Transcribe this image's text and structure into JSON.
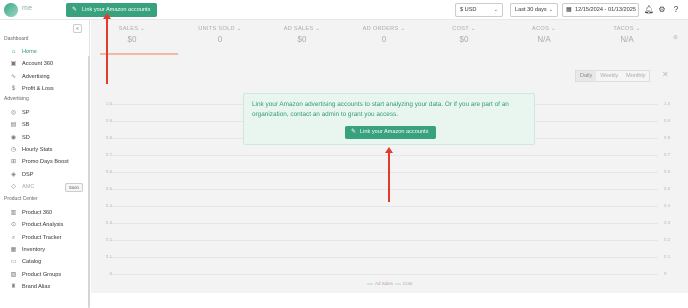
{
  "app": {
    "logo_text": "me"
  },
  "topbar": {
    "link_button": "Link your Amazon accounts",
    "currency": "$ USD",
    "range": "Last 30 days",
    "dates": "12/15/2024 - 01/13/2025"
  },
  "sidebar": {
    "sections": [
      {
        "title": "Dashboard",
        "items": [
          {
            "label": "Home",
            "icon": "home-icon",
            "glyph": "⌂",
            "active": true
          },
          {
            "label": "Account 360",
            "icon": "account-icon",
            "glyph": "▣"
          },
          {
            "label": "Advertising",
            "icon": "trend-icon",
            "glyph": "∿"
          },
          {
            "label": "Profit & Loss",
            "icon": "dollar-icon",
            "glyph": "$"
          }
        ]
      },
      {
        "title": "Advertising",
        "items": [
          {
            "label": "SP",
            "icon": "sp-icon",
            "glyph": "◎"
          },
          {
            "label": "SB",
            "icon": "sb-icon",
            "glyph": "▤"
          },
          {
            "label": "SD",
            "icon": "sd-icon",
            "glyph": "◉"
          },
          {
            "label": "Hourly Stats",
            "icon": "clock-icon",
            "glyph": "◷"
          },
          {
            "label": "Promo Days Boost",
            "icon": "boost-icon",
            "glyph": "⊞"
          },
          {
            "label": "DSP",
            "icon": "dsp-icon",
            "glyph": "◈"
          },
          {
            "label": "AMC",
            "icon": "amc-icon",
            "glyph": "◇",
            "disabled": true,
            "badge": "Soon"
          }
        ]
      },
      {
        "title": "Product Center",
        "items": [
          {
            "label": "Product 360",
            "icon": "product-icon",
            "glyph": "▥"
          },
          {
            "label": "Product Analysis",
            "icon": "analysis-icon",
            "glyph": "⊙"
          },
          {
            "label": "Product Tracker",
            "icon": "tracker-icon",
            "glyph": "⌕"
          },
          {
            "label": "Inventory",
            "icon": "inventory-icon",
            "glyph": "▦"
          },
          {
            "label": "Catalog",
            "icon": "catalog-icon",
            "glyph": "▭"
          },
          {
            "label": "Product Groups",
            "icon": "groups-icon",
            "glyph": "▧"
          },
          {
            "label": "Brand Alias",
            "icon": "brand-icon",
            "glyph": "♜"
          }
        ]
      }
    ]
  },
  "kpis": [
    {
      "label": "SALES",
      "value": "$0"
    },
    {
      "label": "UNITS SOLD",
      "value": "0"
    },
    {
      "label": "AD SALES",
      "value": "$0"
    },
    {
      "label": "AD ORDERS",
      "value": "0"
    },
    {
      "label": "COST",
      "value": "$0"
    },
    {
      "label": "ACOS",
      "value": "N/A"
    },
    {
      "label": "TACOS",
      "value": "N/A"
    }
  ],
  "granularity": [
    "Daily",
    "Weekly",
    "Monthly"
  ],
  "chart_data": {
    "type": "line",
    "y_ticks": [
      "1.0",
      "0.9",
      "0.8",
      "0.7",
      "0.6",
      "0.5",
      "0.4",
      "0.3",
      "0.2",
      "0.1",
      "0"
    ],
    "series": [
      {
        "name": "Ad Sales",
        "values": []
      },
      {
        "name": "Cost",
        "values": []
      }
    ],
    "ylim": [
      0,
      1
    ]
  },
  "overlay": {
    "message": "Link your Amazon advertising accounts to start analyzing your data. Or if you are part of an organization, contact an admin to grant you access.",
    "button": "Link your Amazon accounts"
  },
  "colors": {
    "accent": "#38a27e",
    "annotation": "#e43a2b"
  }
}
